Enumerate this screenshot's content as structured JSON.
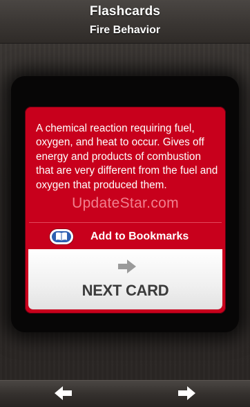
{
  "header": {
    "title": "Flashcards",
    "subtitle": "Fire Behavior"
  },
  "card": {
    "definition": "A chemical reaction requiring fuel, oxygen, and heat to occur. Gives off energy and products of combustion that are very different from the fuel and oxygen that produced them.",
    "watermark": "UpdateStar.com",
    "bookmark_label": "Add to Bookmarks",
    "bookmark_icon": "book-icon",
    "next_label": "NEXT CARD",
    "next_icon": "arrow-right-icon"
  },
  "footer": {
    "prev_icon": "arrow-left-icon",
    "next_icon": "arrow-right-icon"
  },
  "colors": {
    "card_red": "#c8001c",
    "bookmark_blue": "#2d5fb1",
    "header_bg": "#3a3633"
  }
}
